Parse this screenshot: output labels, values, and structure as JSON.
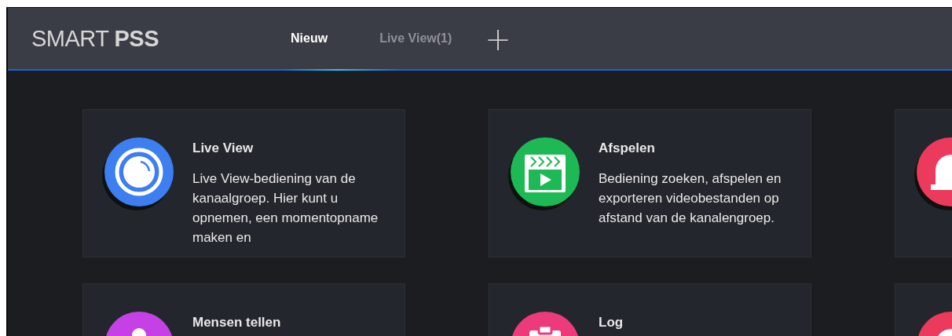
{
  "logo": {
    "light": "SMART",
    "bold": "PSS"
  },
  "tabs": [
    {
      "label": "Nieuw",
      "selected": true
    },
    {
      "label": "Live View(1)",
      "selected": false
    }
  ],
  "add_tab": "+",
  "cards": [
    {
      "kind": "camera",
      "color": "#3d7ef0",
      "title": "Live View",
      "description": "Live View-bediening van de kanaalgroep. Hier kunt u opnemen, een momentopname maken en"
    },
    {
      "kind": "clapper",
      "color": "#1db954",
      "title": "Afspelen",
      "description": "Bediening zoeken, afspelen en exporteren videobestanden op afstand van de kanalengroep."
    },
    {
      "kind": "alarm",
      "color": "#ec3a5c"
    },
    {
      "kind": "people",
      "color": "#c541e6",
      "title": "Mensen tellen"
    },
    {
      "kind": "log",
      "color": "#ec3a7a",
      "title": "Log"
    },
    {
      "kind": "alarm",
      "color": "#ec3a5c"
    }
  ]
}
